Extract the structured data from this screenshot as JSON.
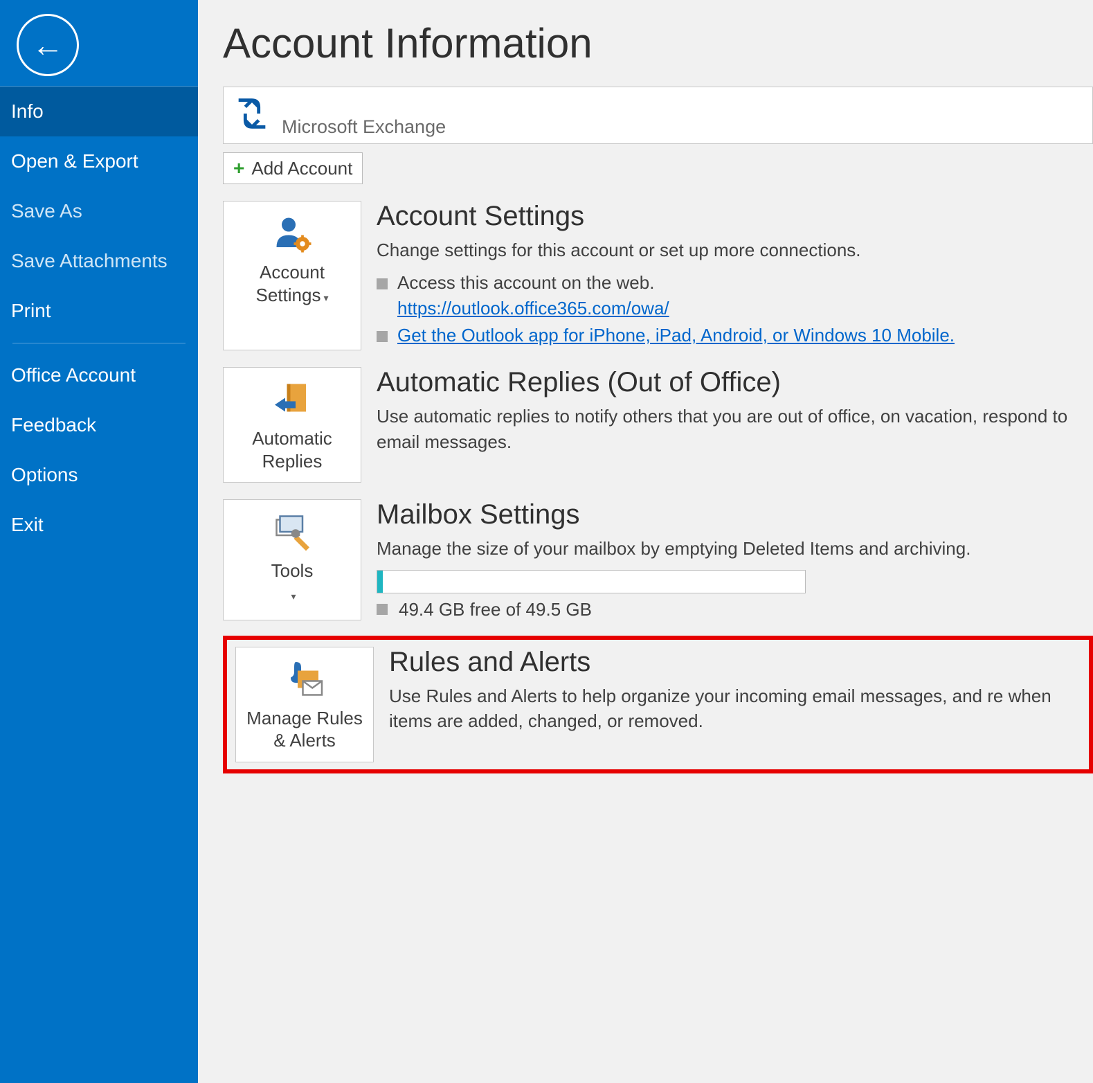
{
  "sidebar": {
    "items": [
      {
        "label": "Info",
        "selected": true
      },
      {
        "label": "Open & Export"
      },
      {
        "label": "Save As",
        "dim": true
      },
      {
        "label": "Save Attachments",
        "dim": true
      },
      {
        "label": "Print"
      },
      {
        "label": "Office Account"
      },
      {
        "label": "Feedback"
      },
      {
        "label": "Options"
      },
      {
        "label": "Exit"
      }
    ]
  },
  "page": {
    "title": "Account Information"
  },
  "account": {
    "type": "Microsoft Exchange",
    "add_button": "Add Account"
  },
  "sections": {
    "settings": {
      "tile": "Account Settings",
      "title": "Account Settings",
      "desc": "Change settings for this account or set up more connections.",
      "bullet1": "Access this account on the web.",
      "link1": "https://outlook.office365.com/owa/",
      "link2": "Get the Outlook app for iPhone, iPad, Android, or Windows 10 Mobile."
    },
    "autoreply": {
      "tile": "Automatic Replies",
      "title": "Automatic Replies (Out of Office)",
      "desc": "Use automatic replies to notify others that you are out of office, on vacation, respond to email messages."
    },
    "mailbox": {
      "tile": "Tools",
      "title": "Mailbox Settings",
      "desc": "Manage the size of your mailbox by emptying Deleted Items and archiving.",
      "storage_text": "49.4 GB free of 49.5 GB"
    },
    "rules": {
      "tile": "Manage Rules & Alerts",
      "title": "Rules and Alerts",
      "desc": "Use Rules and Alerts to help organize your incoming email messages, and re when items are added, changed, or removed."
    }
  }
}
